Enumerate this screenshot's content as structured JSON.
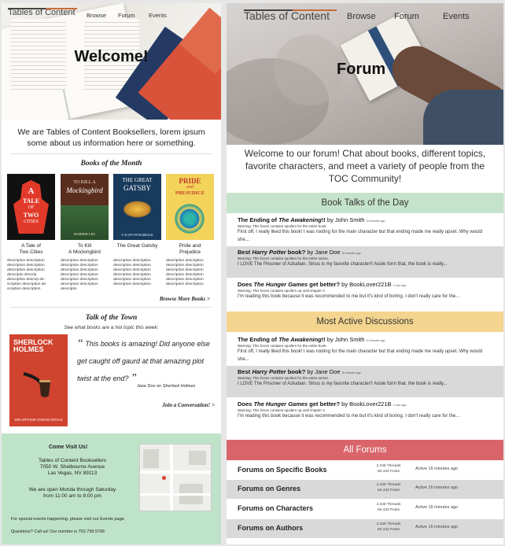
{
  "left": {
    "nav": {
      "logo": "Tables of Content",
      "links": [
        "Browse",
        "Forum",
        "Events"
      ]
    },
    "hero_title": "Welcome!",
    "intro": "We are Tables of Content Booksellers, lorem ipsum some about us information here or something.",
    "books_heading": "Books of the Month",
    "books": [
      {
        "title": "A Tale of\nTwo Cities",
        "cover": [
          "A",
          "TALE",
          "OF",
          "TWO",
          "CITIES"
        ],
        "color": "#e23a2a"
      },
      {
        "title": "To Kill\nA Mockingbird",
        "cover": [
          "TO KILL A",
          "Mockingbird",
          "HARPER LEE"
        ],
        "color": "#5a2e1e"
      },
      {
        "title": "The Great Gatsby",
        "cover": [
          "THE GREAT",
          "GATSBY",
          "F. SCOTT FITZGERALD"
        ],
        "color": "#183a5c"
      },
      {
        "title": "Pride and\nPrejudice",
        "cover": [
          "PRIDE",
          "and",
          "PREJUDICE"
        ],
        "color": "#f4d35a"
      }
    ],
    "book_descriptions": [
      "description description description description description description descriptio descrip description descrip de-scription description de-scription description",
      "description description description description description description description description description description description description descriptio",
      "description description description description description description description description description description description description",
      "description description description description description description description description description description description description"
    ],
    "browse_more": "Browse More Books >",
    "talk_heading": "Talk of the Town",
    "talk_sub": "See what books are a hot topic this week:",
    "sh_cover": {
      "title": "SHERLOCK HOLMES",
      "author": "SIR ARTHUR CONAN DOYLE"
    },
    "quote": "This books is amazing! Did anyone else get caught off gaurd at that amazing plot twist at the end?",
    "quote_by": "Jane Doe on",
    "quote_book": "Sherlock Holmes",
    "join": "Join a Conversation! >",
    "visit": {
      "title": "Come Visit Us!",
      "address": [
        "Tables of Content Booksellers",
        "7050 W. Shelbourne Avenue",
        "Las Vegas, NV 89113"
      ],
      "hours": [
        "We are open Monda through Saturday",
        "from 11:00 am to 8:00 pm"
      ],
      "special": "For special events happening, please visit our Events page.",
      "questions": "Questions? Call us! Our number is 702.799.5766"
    }
  },
  "right": {
    "nav": {
      "logo": "Tables of Content",
      "links": [
        "Browse",
        "Forum",
        "Events"
      ]
    },
    "hero_title": "Forum",
    "intro": "Welcome to our forum! Chat about books, different topics, favorite characters, and meet a variety of people from the TOC Community!",
    "book_talks": {
      "heading": "Book Talks of the Day",
      "color": "#c5e3cb",
      "posts": [
        {
          "pre": "The Ending of ",
          "book": "The Awakening",
          "post": "!!",
          "by": " by John Smith",
          "ago": "10 minutes ago",
          "warn": "Warning: This forum contains spoilers for the entire book.",
          "body": "First off, I really liked this book! I was rooting for the main character but that ending made me really upset. Why would she..."
        },
        {
          "pre": "Best ",
          "book": "Harry Potter",
          "post": " book?",
          "by": " by Jane Doe",
          "ago": "30 minutes ago",
          "warn": "Warning: This forum contains spoilers for the entire series.",
          "body": "I LOVE The Prisoner of Azkaban. Sirius is my favorite character!! Aside form that, the book is really..."
        },
        {
          "pre": "Does ",
          "book": "The Hunger Games",
          "post": " get better?",
          "by": " by BookLover221B",
          "ago": "1 hour ago",
          "warn": "Warning: This forum contains spoilers up until chapter 3.",
          "body": "I'm reading this book because it was recommended to me but it's kind of boring. I don't really care for the..."
        }
      ]
    },
    "active": {
      "heading": "Most Active Discussions",
      "color": "#f4d58f",
      "posts": [
        {
          "pre": "The Ending of ",
          "book": "The Awakening",
          "post": "!!",
          "by": " by John Smith",
          "ago": "10 minutes ago",
          "warn": "Warning: This forum contains spoilers for the entire book.",
          "body": "First off, I really liked this book! I was rooting for the main character but that ending made me really upset. Why would she..."
        },
        {
          "pre": "Best ",
          "book": "Harry Potter",
          "post": " book?",
          "by": " by Jane Doe",
          "ago": "30 minutes ago",
          "warn": "Warning: This forum contains spoilers for the entire series.",
          "body": "I LOVE The Prisoner of Azkaban. Sirius is my favorite character!! Aside form that, the book is really..."
        },
        {
          "pre": "Does ",
          "book": "The Hunger Games",
          "post": " get better?",
          "by": " by BookLover221B",
          "ago": "1 hour ago",
          "warn": "Warning: This forum contains spoilers up until chapter 3.",
          "body": "I'm reading this book because it was recommended to me but it's kind of boring. I don't really care for the..."
        }
      ]
    },
    "all_forums": {
      "heading": "All Forums",
      "color": "#d9656a",
      "rows": [
        {
          "name": "Forums on Specific Books",
          "threads": "2,348 Threads",
          "posts": "60,432 Posts",
          "active": "Active 16 minutes ago"
        },
        {
          "name": "Forums on Genres",
          "threads": "2,348 Threads",
          "posts": "60,432 Posts",
          "active": "Active 16 minutes ago"
        },
        {
          "name": "Forums on Characters",
          "threads": "2,348 Threads",
          "posts": "60,432 Posts",
          "active": "Active 16 minutes ago"
        },
        {
          "name": "Forums on Authors",
          "threads": "2,348 Threads",
          "posts": "60,432 Posts",
          "active": "Active 16 minutes ago"
        }
      ]
    }
  }
}
